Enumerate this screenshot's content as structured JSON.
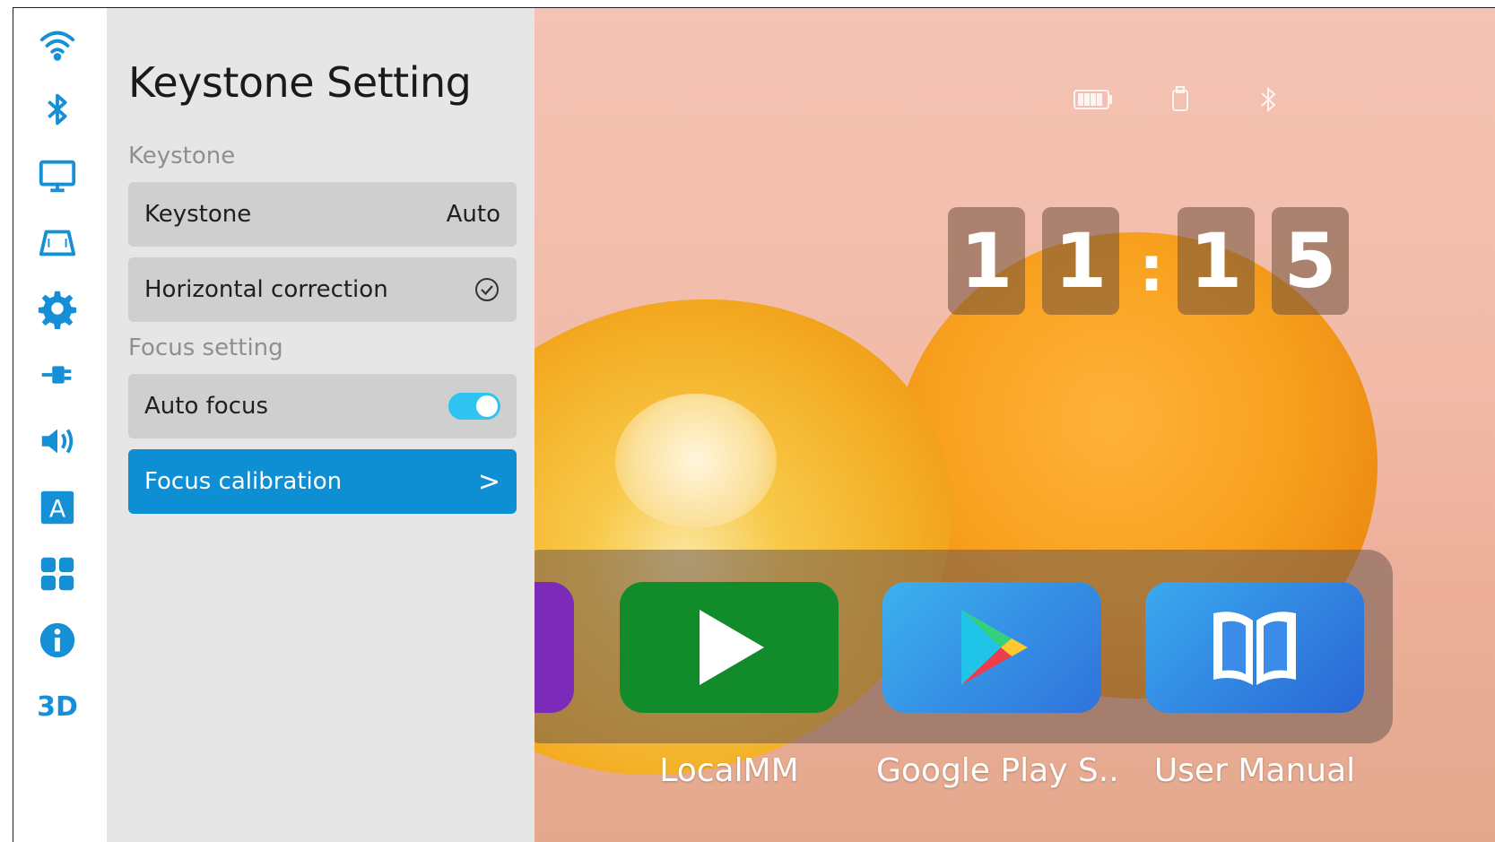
{
  "rail": {
    "items": [
      {
        "icon": "wifi-icon"
      },
      {
        "icon": "bluetooth-icon"
      },
      {
        "icon": "display-icon"
      },
      {
        "icon": "keystone-icon"
      },
      {
        "icon": "gear-icon"
      },
      {
        "icon": "input-source-icon"
      },
      {
        "icon": "speaker-icon"
      },
      {
        "icon": "language-icon",
        "label": "A"
      },
      {
        "icon": "apps-grid-icon"
      },
      {
        "icon": "info-icon"
      },
      {
        "icon": "3d-icon",
        "label": "3D"
      }
    ],
    "accent": "#1590d6"
  },
  "panel": {
    "title": "Keystone Setting",
    "sections": [
      {
        "label": "Keystone",
        "rows": [
          {
            "label": "Keystone",
            "value": "Auto"
          },
          {
            "label": "Horizontal correction",
            "control": "check-circle-icon"
          }
        ]
      },
      {
        "label": "Focus setting",
        "rows": [
          {
            "label": "Auto focus",
            "control": "toggle",
            "toggle_on": true
          },
          {
            "label": "Focus calibration",
            "control": "chevron-right-icon",
            "chevron": ">",
            "selected": true
          }
        ]
      }
    ],
    "highlight_color": "#0e8fd4"
  },
  "status_bar": {
    "icons": [
      "battery-icon",
      "usb-icon",
      "bluetooth-icon"
    ]
  },
  "clock": {
    "digits": [
      "1",
      "1",
      "1",
      "5"
    ],
    "separator": ":"
  },
  "apps": [
    {
      "label": "",
      "icon": "app-partial-icon",
      "color": "#7b2bb8"
    },
    {
      "label": "LocalMM",
      "icon": "play-icon",
      "color": "#128b2a"
    },
    {
      "label": "Google Play S..",
      "icon": "google-play-icon",
      "color": "#2f8fe3"
    },
    {
      "label": "User Manual",
      "icon": "book-icon",
      "color": "#2d7ee0"
    }
  ]
}
